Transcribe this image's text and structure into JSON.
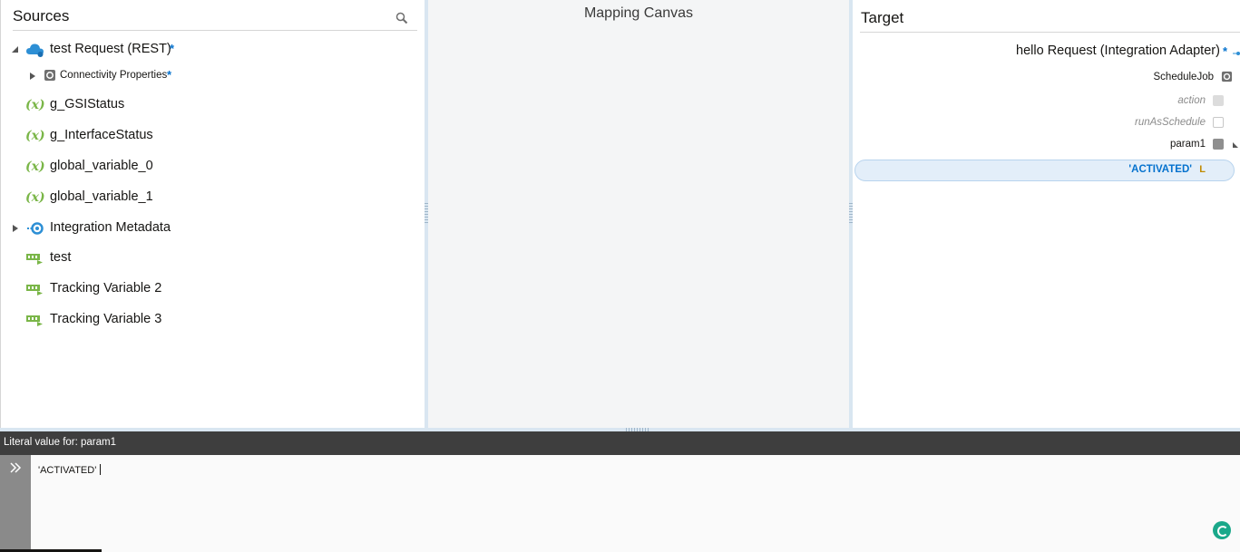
{
  "sources": {
    "title": "Sources",
    "items": [
      {
        "label": "test Request (REST)",
        "star": "*",
        "icon": "rest-cloud-icon",
        "expanded": true
      },
      {
        "label": "Connectivity Properties",
        "star": "*",
        "icon": "properties-icon",
        "expanded": false
      },
      {
        "label": "g_GSIStatus",
        "icon_text": "(x)"
      },
      {
        "label": "g_InterfaceStatus",
        "icon_text": "(x)"
      },
      {
        "label": "global_variable_0",
        "icon_text": "(x)"
      },
      {
        "label": "global_variable_1",
        "icon_text": "(x)"
      },
      {
        "label": "Integration Metadata",
        "icon": "metadata-icon",
        "expanded": false
      },
      {
        "label": "test",
        "icon": "tracking-variable-icon"
      },
      {
        "label": "Tracking Variable 2",
        "icon": "tracking-variable-icon"
      },
      {
        "label": "Tracking Variable 3",
        "icon": "tracking-variable-icon"
      }
    ]
  },
  "canvas": {
    "title": "Mapping Canvas"
  },
  "target": {
    "title": "Target",
    "root": {
      "label": "hello Request (Integration Adapter)",
      "star": "*"
    },
    "items": [
      {
        "label": "ScheduleJob"
      },
      {
        "label": "action"
      },
      {
        "label": "runAsSchedule"
      },
      {
        "label": "param1"
      }
    ],
    "selected_literal": "'ACTIVATED'",
    "literal_badge": "L"
  },
  "editor": {
    "title": "Literal value for: param1",
    "value": "'ACTIVATED'"
  },
  "colors": {
    "accent": "#0572ce",
    "variable_green": "#7ab648",
    "selection_bg": "#e3eef9"
  }
}
